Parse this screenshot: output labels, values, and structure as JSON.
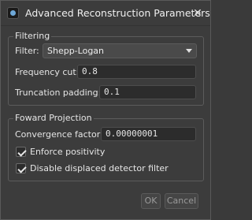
{
  "window": {
    "title": "Advanced Reconstruction Parameters",
    "close_glyph": "✕"
  },
  "filtering": {
    "group_title": "Filtering",
    "filter_label": "Filter:",
    "filter_value": "Shepp-Logan",
    "frequency_cut_label": "Frequency cut:",
    "frequency_cut_value": "0.8",
    "truncation_padding_label": "Truncation padding:",
    "truncation_padding_value": "0.1"
  },
  "forward_projection": {
    "group_title": "Foward Projection",
    "convergence_factor_label": "Convergence factor:",
    "convergence_factor_value": "0.00000001",
    "enforce_positivity_label": "Enforce positivity",
    "enforce_positivity_checked": true,
    "disable_displaced_label": "Disable displaced detector filter",
    "disable_displaced_checked": true
  },
  "buttons": {
    "ok_label": "OK",
    "cancel_label": "Cancel"
  }
}
